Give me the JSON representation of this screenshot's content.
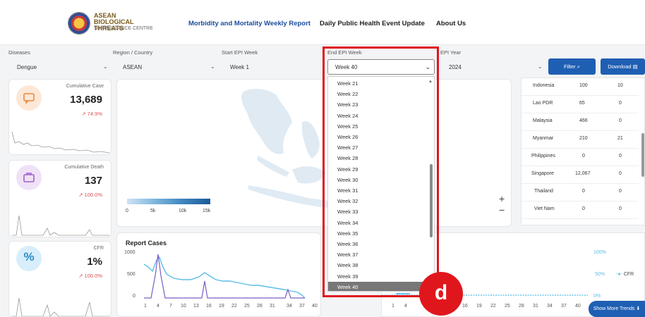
{
  "header": {
    "logo_line1": "ASEAN",
    "logo_line2": "BIOLOGICAL THREATS",
    "logo_line3": "SURVEILLANCE CENTRE",
    "nav": [
      {
        "label": "Morbidity and Mortality Weekly Report",
        "active": true
      },
      {
        "label": "Daily Public Health Event Update",
        "active": false
      },
      {
        "label": "About Us",
        "active": false
      }
    ]
  },
  "filters": {
    "diseases_label": "Diseases",
    "diseases_value": "Dengue",
    "region_label": "Region / Country",
    "region_value": "ASEAN",
    "start_label": "Start EPI Week",
    "start_value": "Week 1",
    "end_label": "End EPI Week",
    "end_value": "Week 40",
    "year_label": "EPI Year",
    "year_value": "2024",
    "filter_btn": "Filter",
    "download_btn": "Download"
  },
  "cards": {
    "cases_label": "Cumulative Case",
    "cases_value": "13,689",
    "cases_pct": "↗ 74.9%",
    "death_label": "Cumulative Death",
    "death_value": "137",
    "death_pct": "↗ 100.0%",
    "cfr_label": "CFR",
    "cfr_value": "1%",
    "cfr_pct": "↗ 100.0%"
  },
  "map_legend": [
    "0",
    "5k",
    "10k",
    "15k"
  ],
  "zoom": {
    "plus": "+",
    "minus": "−"
  },
  "table_rows": [
    {
      "country": "Indonesia",
      "cases": "100",
      "deaths": "10"
    },
    {
      "country": "Lao PDR",
      "cases": "65",
      "deaths": "0"
    },
    {
      "country": "Malaysia",
      "cases": "466",
      "deaths": "0"
    },
    {
      "country": "Myanmar",
      "cases": "210",
      "deaths": "21"
    },
    {
      "country": "Philippines",
      "cases": "0",
      "deaths": "0"
    },
    {
      "country": "Singapore",
      "cases": "12,067",
      "deaths": "0"
    },
    {
      "country": "Thailand",
      "cases": "0",
      "deaths": "0"
    },
    {
      "country": "Viet Nam",
      "cases": "0",
      "deaths": "0"
    }
  ],
  "dropdown": {
    "options": [
      "Week 21",
      "Week 22",
      "Week 23",
      "Week 24",
      "Week 25",
      "Week 26",
      "Week 27",
      "Week 28",
      "Week 29",
      "Week 30",
      "Week 31",
      "Week 32",
      "Week 33",
      "Week 34",
      "Week 35",
      "Week 36",
      "Week 37",
      "Week 38",
      "Week 39",
      "Week 40"
    ],
    "selected": "Week 40"
  },
  "annotation_badge": "d",
  "report": {
    "title": "Report Cases",
    "y_ticks": [
      "1000",
      "500",
      "0"
    ],
    "x_ticks": [
      "1",
      "4",
      "7",
      "10",
      "13",
      "16",
      "19",
      "22",
      "25",
      "28",
      "31",
      "34",
      "37",
      "40"
    ]
  },
  "cfr_chart": {
    "y_ticks": [
      "100%",
      "50%",
      "0%"
    ],
    "legend": "CFR",
    "x_ticks": [
      "1",
      "4",
      "",
      "",
      "16",
      "19",
      "22",
      "25",
      "28",
      "31",
      "34",
      "37",
      "40"
    ]
  },
  "show_more": "Show More Trends ⬇"
}
